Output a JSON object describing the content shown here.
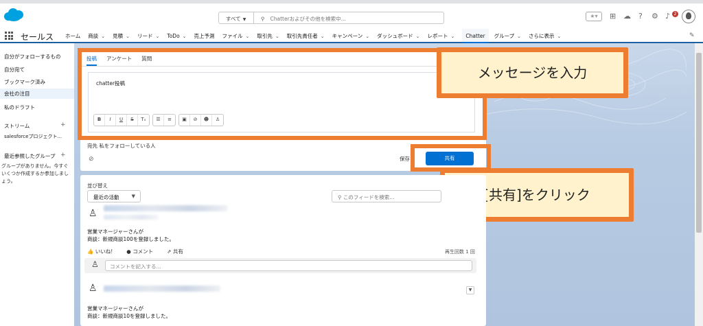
{
  "header": {
    "scope_label": "すべて",
    "search_placeholder": "Chatterおよびその他を検索中...",
    "notification_count": "2"
  },
  "nav": {
    "app_name": "セールス",
    "items": [
      {
        "label": "ホーム",
        "dropdown": false
      },
      {
        "label": "商談",
        "dropdown": true
      },
      {
        "label": "見積",
        "dropdown": true
      },
      {
        "label": "リード",
        "dropdown": true
      },
      {
        "label": "ToDo",
        "dropdown": true
      },
      {
        "label": "売上予測",
        "dropdown": false
      },
      {
        "label": "ファイル",
        "dropdown": true
      },
      {
        "label": "取引先",
        "dropdown": true
      },
      {
        "label": "取引先責任者",
        "dropdown": true
      },
      {
        "label": "キャンペーン",
        "dropdown": true
      },
      {
        "label": "ダッシュボード",
        "dropdown": true
      },
      {
        "label": "レポート",
        "dropdown": true
      },
      {
        "label": "Chatter",
        "dropdown": false,
        "active": true
      },
      {
        "label": "グループ",
        "dropdown": true
      },
      {
        "label": "さらに表示",
        "dropdown": true
      }
    ]
  },
  "sidebar": {
    "items": [
      {
        "label": "自分がフォローするもの"
      },
      {
        "label": "自分宛て"
      },
      {
        "label": "ブックマーク済み"
      },
      {
        "label": "会社の注目",
        "selected": true
      },
      {
        "label": "私のドラフト"
      }
    ],
    "streams_label": "ストリーム",
    "stream_item": "salesforceプロジェクト...",
    "groups_label": "最近参照したグループ",
    "groups_note": "グループがありません。今すぐいくつか作成するか参加しましょう。"
  },
  "publisher": {
    "tabs": [
      "投稿",
      "アンケート",
      "質問"
    ],
    "active_tab": 0,
    "post_text": "chatter投稿",
    "to_text": "宛先 私をフォローしている人",
    "save_label": "保存",
    "share_label": "共有"
  },
  "callouts": {
    "message": "メッセージを入力",
    "click_share": "[共有]をクリック"
  },
  "feed": {
    "sort_label": "並び替え",
    "sort_value": "最近の活動",
    "search_placeholder": "このフィードを検索...",
    "posts": [
      {
        "line1": "営業マネージャーさんが",
        "line2": "商談：新規商談100を登録しました。",
        "like_label": "いいね!",
        "comment_label": "コメント",
        "share_label": "共有",
        "views": "再生回数 1 回",
        "comment_placeholder": "コメントを記入する..."
      },
      {
        "line1": "営業マネージャーさんが",
        "line2": "商談：新規商談10を登録しました。"
      }
    ]
  },
  "colors": {
    "accent": "#0070d2",
    "highlight": "#ed7d31",
    "callout_fill": "#fff2cc",
    "logo": "#00a1e0"
  }
}
